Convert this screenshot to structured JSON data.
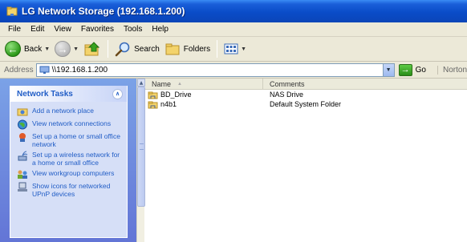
{
  "window": {
    "title": "LG Network Storage (192.168.1.200)"
  },
  "menubar": {
    "items": [
      "File",
      "Edit",
      "View",
      "Favorites",
      "Tools",
      "Help"
    ]
  },
  "toolbar": {
    "back_label": "Back",
    "search_label": "Search",
    "folders_label": "Folders"
  },
  "addressbar": {
    "label": "Address",
    "value": "\\\\192.168.1.200",
    "go_label": "Go",
    "extra_label": "Norton"
  },
  "tasks": {
    "header": "Network Tasks",
    "items": [
      {
        "label": "Add a network place",
        "icon": "network-place-icon"
      },
      {
        "label": "View network connections",
        "icon": "globe-icon"
      },
      {
        "label": "Set up a home or small office network",
        "icon": "home-network-icon"
      },
      {
        "label": "Set up a wireless network for a home or small office",
        "icon": "wireless-icon"
      },
      {
        "label": "View workgroup computers",
        "icon": "workgroup-icon"
      },
      {
        "label": "Show icons for networked UPnP devices",
        "icon": "upnp-icon"
      }
    ]
  },
  "list": {
    "columns": [
      "Name",
      "Comments"
    ],
    "rows": [
      {
        "name": "BD_Drive",
        "comment": "NAS Drive"
      },
      {
        "name": "n4b1",
        "comment": "Default System Folder"
      }
    ]
  },
  "colors": {
    "title_bar": "#0a4cc8",
    "task_pane": "#7ba2e7",
    "task_link": "#215dc6"
  }
}
